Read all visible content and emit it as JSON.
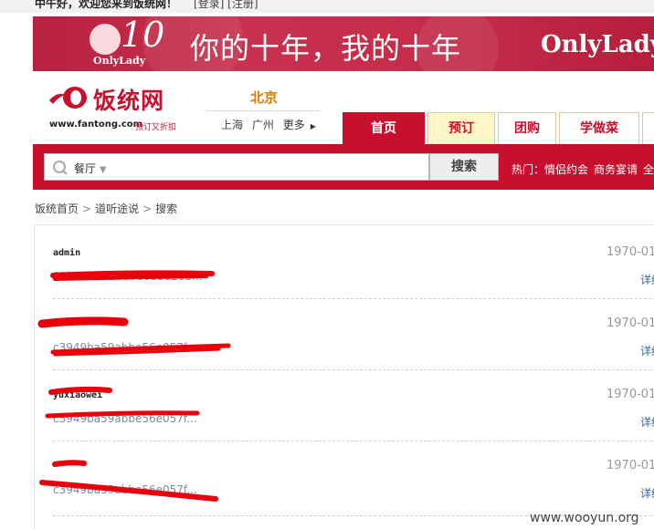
{
  "topbar": {
    "welcome": "中午好，欢迎您来到饭统网！",
    "login": "[登录] [注册]"
  },
  "banner": {
    "anniversary": "10",
    "brand_small": "OnlyLady",
    "slogan": "你的十年，我的十年",
    "brand": "OnlyLady"
  },
  "logo": {
    "name": "饭统网",
    "url": "www.fantong.com",
    "slogan": "预订又折扣"
  },
  "city": {
    "current": "北京",
    "others": [
      "上海",
      "广州"
    ],
    "more": "更多"
  },
  "nav": {
    "tabs": [
      {
        "label": "首页"
      },
      {
        "label": "预订"
      },
      {
        "label": "团购"
      },
      {
        "label": "学做菜"
      }
    ]
  },
  "search": {
    "category": "餐厅",
    "button": "搜索",
    "hot_label": "热门：",
    "hot": [
      "情侣约会",
      "商务宴请",
      "全"
    ]
  },
  "breadcrumb": [
    "饭统首页",
    "道听途说",
    "搜索"
  ],
  "posts": [
    {
      "user": "admin",
      "hash": "03ba1220550760a3d205...",
      "date": "1970-01",
      "detail": "详细"
    },
    {
      "user": "",
      "hash": "c3949ba59abbe56e057f...",
      "date": "1970-01",
      "detail": "详细"
    },
    {
      "user": "yuxiaowei",
      "hash": "c3949ba59abbe56e057f...",
      "date": "1970-01",
      "detail": "详细"
    },
    {
      "user": "",
      "hash": "c3949ba59abbe56e057f...",
      "date": "1970-01",
      "detail": "详细"
    }
  ],
  "watermark": "www.wooyun.org",
  "colors": {
    "brand_red": "#c8102e",
    "banner": "#c42b48",
    "city": "#e07b00",
    "link": "#2a62a9",
    "redaction": "#e8000b"
  }
}
